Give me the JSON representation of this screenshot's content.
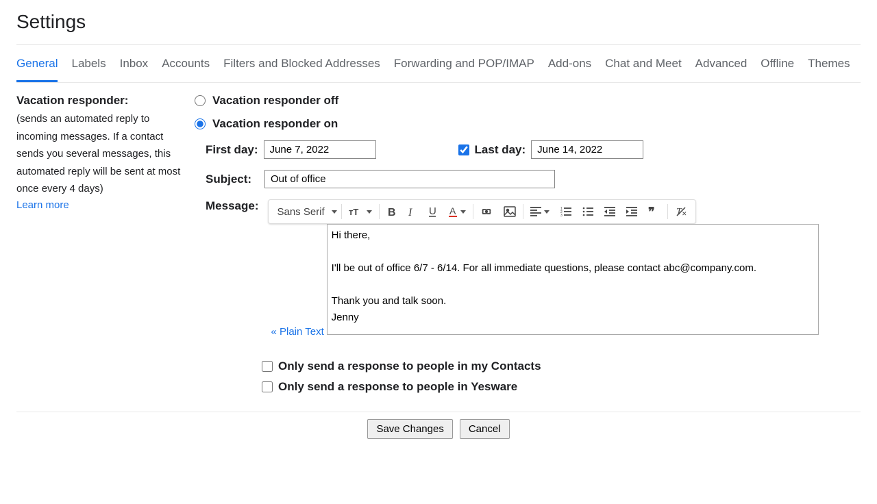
{
  "header": {
    "title": "Settings"
  },
  "tabs": [
    "General",
    "Labels",
    "Inbox",
    "Accounts",
    "Filters and Blocked Addresses",
    "Forwarding and POP/IMAP",
    "Add-ons",
    "Chat and Meet",
    "Advanced",
    "Offline",
    "Themes"
  ],
  "vacation": {
    "section_title": "Vacation responder:",
    "section_desc": "(sends an automated reply to incoming messages. If a contact sends you several messages, this automated reply will be sent at most once every 4 days)",
    "learn_more": "Learn more",
    "off_label": "Vacation responder off",
    "on_label": "Vacation responder on",
    "first_day_label": "First day:",
    "last_day_label": "Last day:",
    "subject_label": "Subject:",
    "message_label": "Message:",
    "first_day_value": "June 7, 2022",
    "last_day_value": "June 14, 2022",
    "subject_value": "Out of office",
    "font_name": "Sans Serif",
    "plain_text_link": "« Plain Text",
    "message_body": "Hi there,\n\nI'll be out of office 6/7 - 6/14. For all immediate questions, please contact abc@company.com.\n\nThank you and talk soon.\nJenny",
    "contacts_checkbox": "Only send a response to people in my Contacts",
    "yesware_checkbox": "Only send a response to people in Yesware"
  },
  "buttons": {
    "save": "Save Changes",
    "cancel": "Cancel"
  }
}
